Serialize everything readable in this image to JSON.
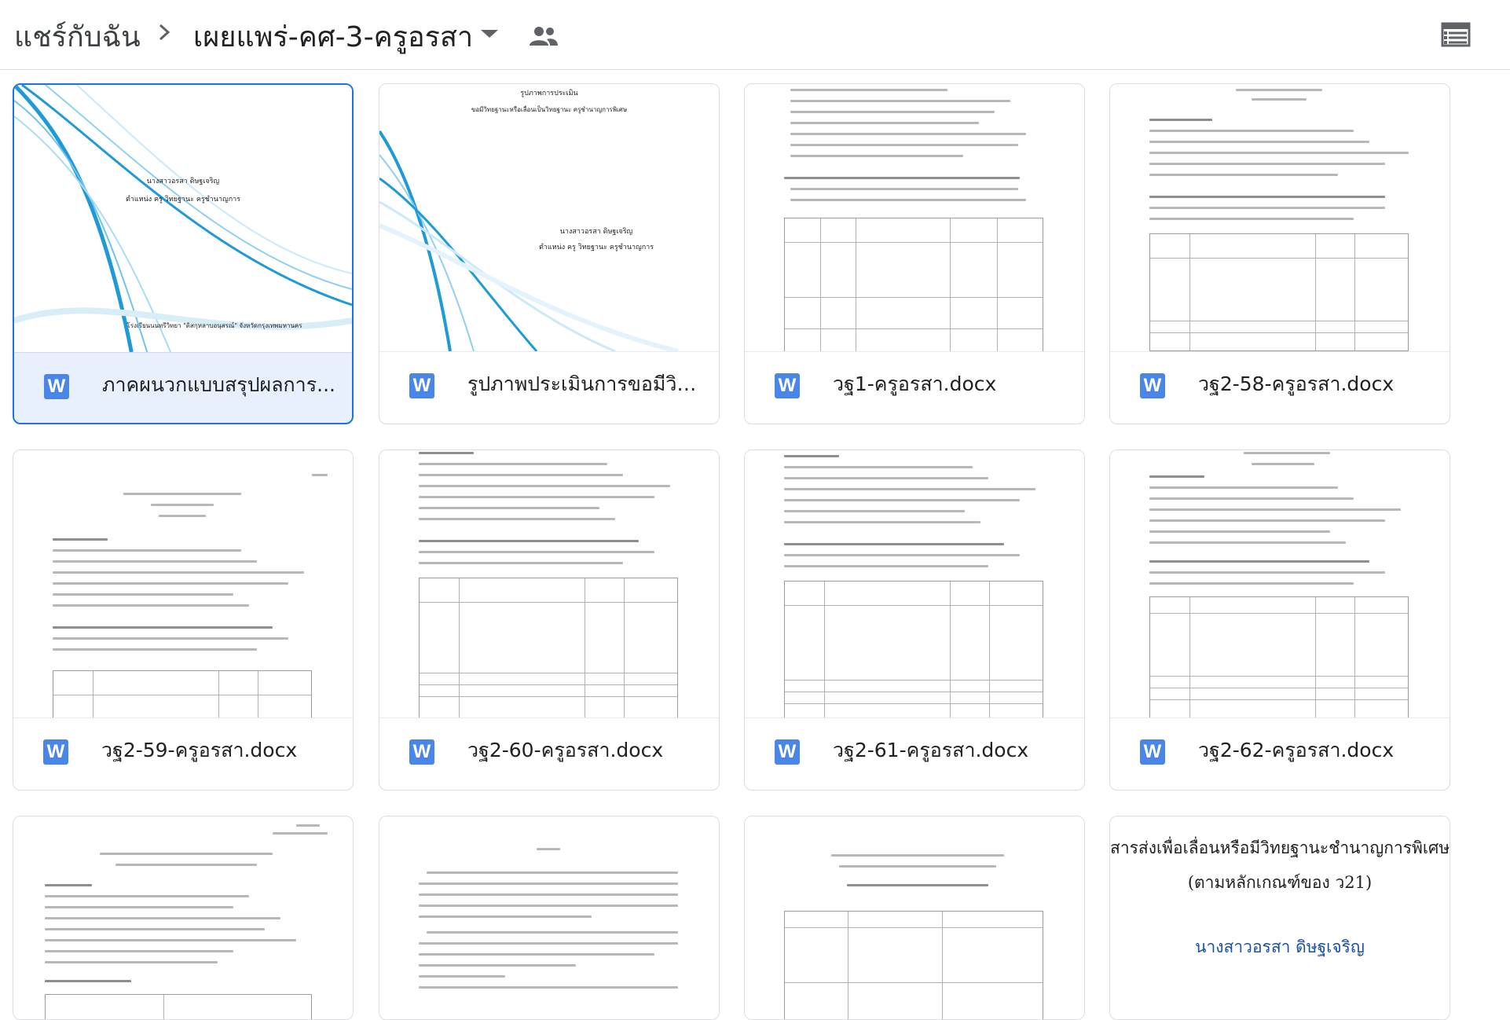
{
  "breadcrumb": {
    "root": "แชร์กับฉัน",
    "current": "เผยแพร่-คศ-3-ครูอรสา"
  },
  "icons": {
    "separator": "chevron-right-icon",
    "dropdown": "caret-down-icon",
    "shared": "people-icon",
    "view": "list-view-icon",
    "file_type": "word-icon"
  },
  "accent_color": "#1a73e8",
  "word_color": "#4a86e8",
  "files": [
    {
      "name": "ภาคผนวกแบบสรุปผลการ...",
      "type": "W",
      "selected": true
    },
    {
      "name": "รูปภาพประเมินการขอมีวิท...",
      "type": "W"
    },
    {
      "name": "วฐ1-ครูอรสา.docx",
      "type": "W"
    },
    {
      "name": "วฐ2-58-ครูอรสา.docx",
      "type": "W"
    },
    {
      "name": "วฐ2-59-ครูอรสา.docx",
      "type": "W"
    },
    {
      "name": "วฐ2-60-ครูอรสา.docx",
      "type": "W"
    },
    {
      "name": "วฐ2-61-ครูอรสา.docx",
      "type": "W"
    },
    {
      "name": "วฐ2-62-ครูอรสา.docx",
      "type": "W"
    },
    {
      "name": "",
      "type": "W"
    },
    {
      "name": "",
      "type": "W"
    },
    {
      "name": "",
      "type": "W"
    },
    {
      "name": "",
      "type": "W"
    }
  ],
  "thumb_text": {
    "t1_name": "นางสาวอรสา ดิษฐเจริญ",
    "t1_pos": "ตำแหน่ง ครู วิทยฐานะ ครูชำนาญการ",
    "t1_school": "โรงเรียนนนทรีวิทยา \"ดิสกุหลาบอนุสรณ์\" จังหวัดกรุงเทพมหานคร",
    "t2_title": "รูปภาพการประเมิน",
    "t2_sub": "ขอมีวิทยฐานะหรือเลื่อนเป็นวิทยฐานะ ครูชำนาญการพิเศษ",
    "t2_name": "นางสาวอรสา ดิษฐเจริญ",
    "t2_pos": "ตำแหน่ง ครู วิทยฐานะ ครูชำนาญการ",
    "t12_title": "สารส่งเพื่อเลื่อนหรือมีวิทยฐานะชำนาญการพิเศษ",
    "t12_sub": "(ตามหลักเกณฑ์ของ ว21)",
    "t12_name": "นางสาวอรสา  ดิษฐเจริญ"
  }
}
